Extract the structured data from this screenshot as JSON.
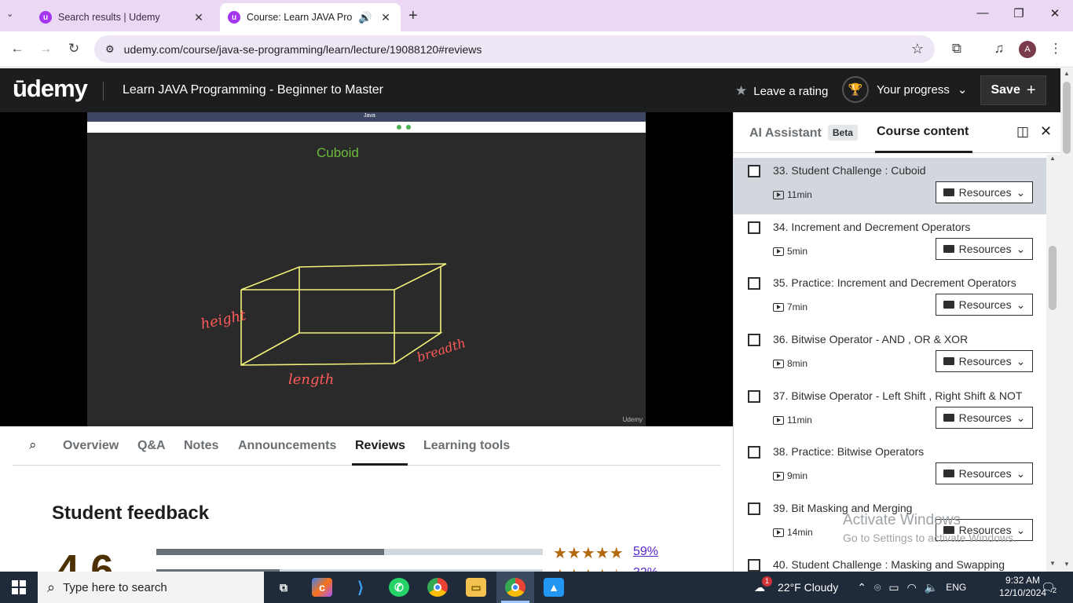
{
  "browser": {
    "tabs": [
      {
        "title": "Search results | Udemy",
        "favicon": "udemy-logo-icon"
      },
      {
        "title": "Course: Learn JAVA Program",
        "favicon": "udemy-logo-icon",
        "audio": "speaker-icon"
      }
    ],
    "new_tab": "+",
    "address": "udemy.com/course/java-se-programming/learn/lecture/19088120#reviews",
    "profile_initial": "A"
  },
  "header": {
    "logo": "ūdemy",
    "course_title": "Learn JAVA Programming - Beginner to Master",
    "leave_rating": "Leave a rating",
    "your_progress": "Your progress",
    "save": "Save"
  },
  "video": {
    "title": "Cuboid",
    "toolbar_title": "Java",
    "labels": {
      "height": "height",
      "length": "length",
      "breadth": "breadth"
    },
    "watermark": "Udemy"
  },
  "tabs": [
    "Overview",
    "Q&A",
    "Notes",
    "Announcements",
    "Reviews",
    "Learning tools"
  ],
  "active_tab": "Reviews",
  "feedback": {
    "heading": "Student feedback",
    "average": "4.6",
    "rows": [
      {
        "percent": "59%",
        "fill": 0.59,
        "stars": 5
      },
      {
        "percent": "32%",
        "fill": 0.32,
        "stars": 4
      }
    ]
  },
  "sidebar": {
    "ai_tab": "AI Assistant",
    "ai_badge": "Beta",
    "content_tab": "Course content",
    "resources_label": "Resources",
    "lectures": [
      {
        "title": "33. Student Challenge : Cuboid",
        "duration": "11min",
        "current": true
      },
      {
        "title": "34. Increment and Decrement Operators",
        "duration": "5min"
      },
      {
        "title": "35. Practice: Increment and Decrement Operators",
        "duration": "7min"
      },
      {
        "title": "36. Bitwise Operator - AND , OR & XOR",
        "duration": "8min"
      },
      {
        "title": "37. Bitwise Operator - Left Shift , Right Shift & NOT",
        "duration": "11min"
      },
      {
        "title": "38. Practice: Bitwise Operators",
        "duration": "9min"
      },
      {
        "title": "39. Bit Masking and Merging",
        "duration": "14min"
      },
      {
        "title": "40. Student Challenge : Masking and Swapping",
        "duration": ""
      }
    ]
  },
  "watermark": {
    "line1": "Activate Windows",
    "line2": "Go to Settings to activate Windows."
  },
  "taskbar": {
    "search_placeholder": "Type here to search",
    "weather": "22°F  Cloudy",
    "weather_badge": "1",
    "language": "ENG",
    "time": "9:32 AM",
    "date": "12/10/2024",
    "notifications": "2"
  }
}
